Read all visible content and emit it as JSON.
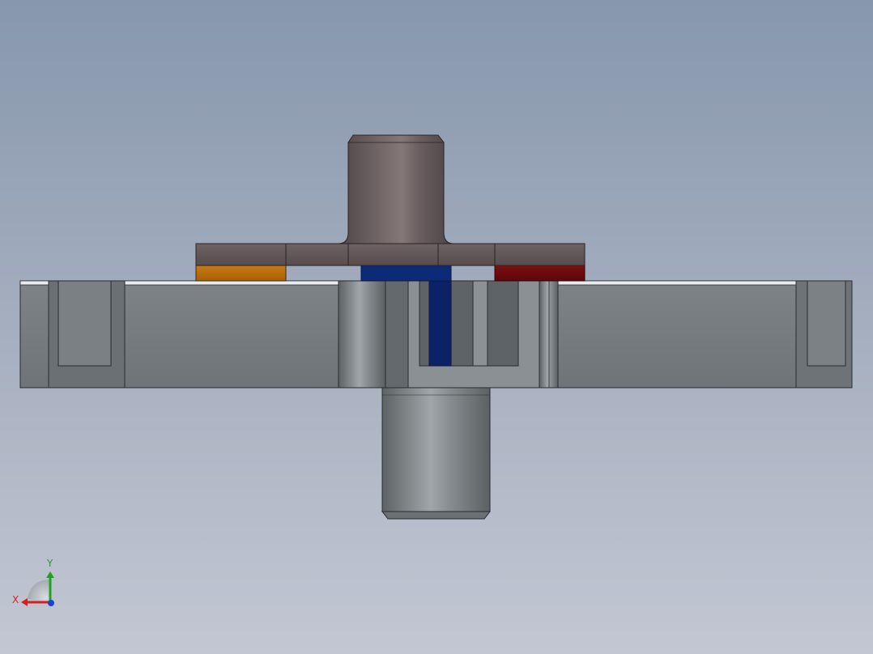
{
  "viewport": {
    "background_top": "#8797ad",
    "background_bottom": "#c3c7d3"
  },
  "model": {
    "colors": {
      "base_plate": "#757b80",
      "base_plate_dark": "#5f6569",
      "flange": "#5e5354",
      "boss": "#5b5051",
      "shaft": "#7a8084",
      "orange_part": "#b86c0a",
      "blue_part": "#0d2a78",
      "red_part": "#6d0a0d"
    }
  },
  "triad": {
    "x_label": "X",
    "y_label": "Y",
    "x_color": "#d81e1e",
    "y_color": "#1fa31f",
    "z_color": "#1e3fd8",
    "icon": "coordinate-triad-icon"
  }
}
